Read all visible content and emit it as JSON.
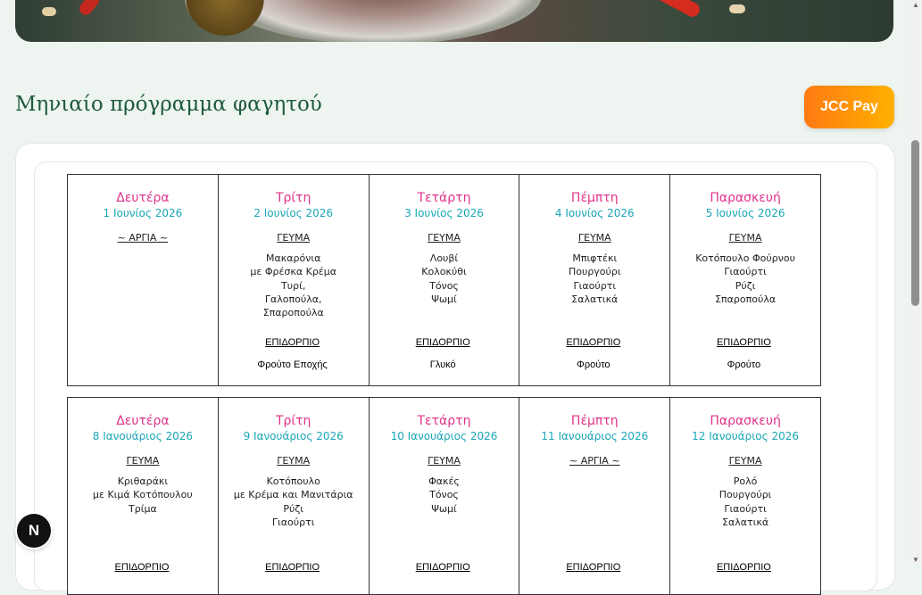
{
  "page": {
    "title": "Μηνιαίο πρόγραμμα φαγητού",
    "pay_button": "JCC Pay",
    "badge": "N"
  },
  "colors": {
    "day_name": "#e0338a",
    "date": "#1aa6b7",
    "title": "#1d5a3d",
    "pay_gradient_start": "#ff7a12",
    "pay_gradient_end": "#ffb100"
  },
  "labels": {
    "lunch": "ΓΕΥΜΑ",
    "dessert": "ΕΠΙΔΟΡΠΙΟ",
    "holiday": "~ ΑΡΓΙΑ ~"
  },
  "weeks": [
    {
      "days": [
        {
          "name": "Δευτέρα",
          "date": "1 Ιουνίος 2026",
          "holiday": true,
          "lunch": [],
          "dessert": ""
        },
        {
          "name": "Τρίτη",
          "date": "2 Ιουνίος 2026",
          "holiday": false,
          "lunch": [
            "Μακαρόνια",
            "με Φρέσκα Κρέμα",
            "Τυρί,",
            "Γαλοπούλα,",
            "Σπαροπούλα"
          ],
          "dessert": "Φρούτο Εποχής"
        },
        {
          "name": "Τετάρτη",
          "date": "3 Ιουνίος 2026",
          "holiday": false,
          "lunch": [
            "Λουβί",
            "Κολοκύθι",
            "Τόνος",
            "Ψωμί"
          ],
          "dessert": "Γλυκό"
        },
        {
          "name": "Πέμπτη",
          "date": "4 Ιουνίος 2026",
          "holiday": false,
          "lunch": [
            "Μπιφτέκι",
            "Πουργούρι",
            "Γιαούρτι",
            "Σαλατικά"
          ],
          "dessert": "Φρούτο"
        },
        {
          "name": "Παρασκευή",
          "date": "5 Ιουνίος 2026",
          "holiday": false,
          "lunch": [
            "Κοτόπουλο Φούρνου",
            "Γιαούρτι",
            "Ρύζι",
            "Σπαροπούλα"
          ],
          "dessert": "Φρούτο"
        }
      ]
    },
    {
      "days": [
        {
          "name": "Δευτέρα",
          "date": "8 Ιανουάριος 2026",
          "holiday": false,
          "lunch": [
            "Κριθαράκι",
            "με Κιμά Κοτόπουλου",
            "Τρίμα"
          ],
          "dessert": ""
        },
        {
          "name": "Τρίτη",
          "date": "9 Ιανουάριος 2026",
          "holiday": false,
          "lunch": [
            "Κοτόπουλο",
            "με Κρέμα και Μανιτάρια",
            "Ρύζι",
            "Γιαούρτι"
          ],
          "dessert": ""
        },
        {
          "name": "Τετάρτη",
          "date": "10 Ιανουάριος 2026",
          "holiday": false,
          "lunch": [
            "Φακές",
            "Τόνος",
            "Ψωμί"
          ],
          "dessert": ""
        },
        {
          "name": "Πέμπτη",
          "date": "11 Ιανουάριος 2026",
          "holiday": true,
          "lunch": [],
          "dessert": ""
        },
        {
          "name": "Παρασκευή",
          "date": "12 Ιανουάριος 2026",
          "holiday": false,
          "lunch": [
            "Ρολό",
            "Πουργούρι",
            "Γιαούρτι",
            "Σαλατικά"
          ],
          "dessert": ""
        }
      ]
    }
  ]
}
